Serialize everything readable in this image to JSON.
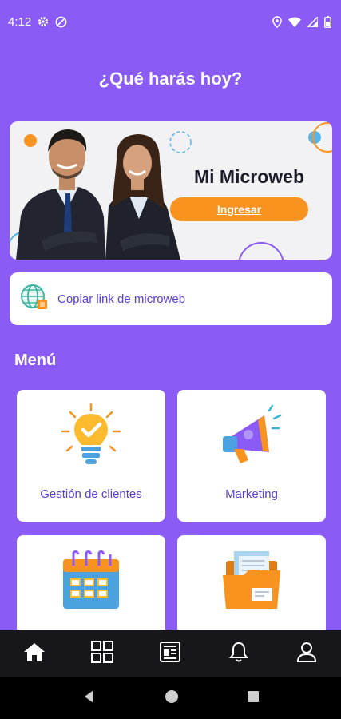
{
  "status_bar": {
    "time": "4:12"
  },
  "headline": "¿Qué harás hoy?",
  "banner": {
    "title": "Mi Microweb",
    "button_label": "Ingresar"
  },
  "copy_link": {
    "label": "Copiar link de microweb"
  },
  "menu": {
    "title": "Menú",
    "items": [
      {
        "label": "Gestión de clientes",
        "icon": "lightbulb-icon"
      },
      {
        "label": "Marketing",
        "icon": "megaphone-icon"
      },
      {
        "label": "",
        "icon": "calendar-icon"
      },
      {
        "label": "",
        "icon": "folder-icon"
      }
    ]
  },
  "bottom_nav": [
    "home-icon",
    "grid-icon",
    "news-icon",
    "bell-icon",
    "profile-icon"
  ],
  "colors": {
    "background": "#8a5cf5",
    "accent_orange": "#f7931e",
    "label_purple": "#5b3fd0",
    "nav_bar": "#16161b"
  }
}
